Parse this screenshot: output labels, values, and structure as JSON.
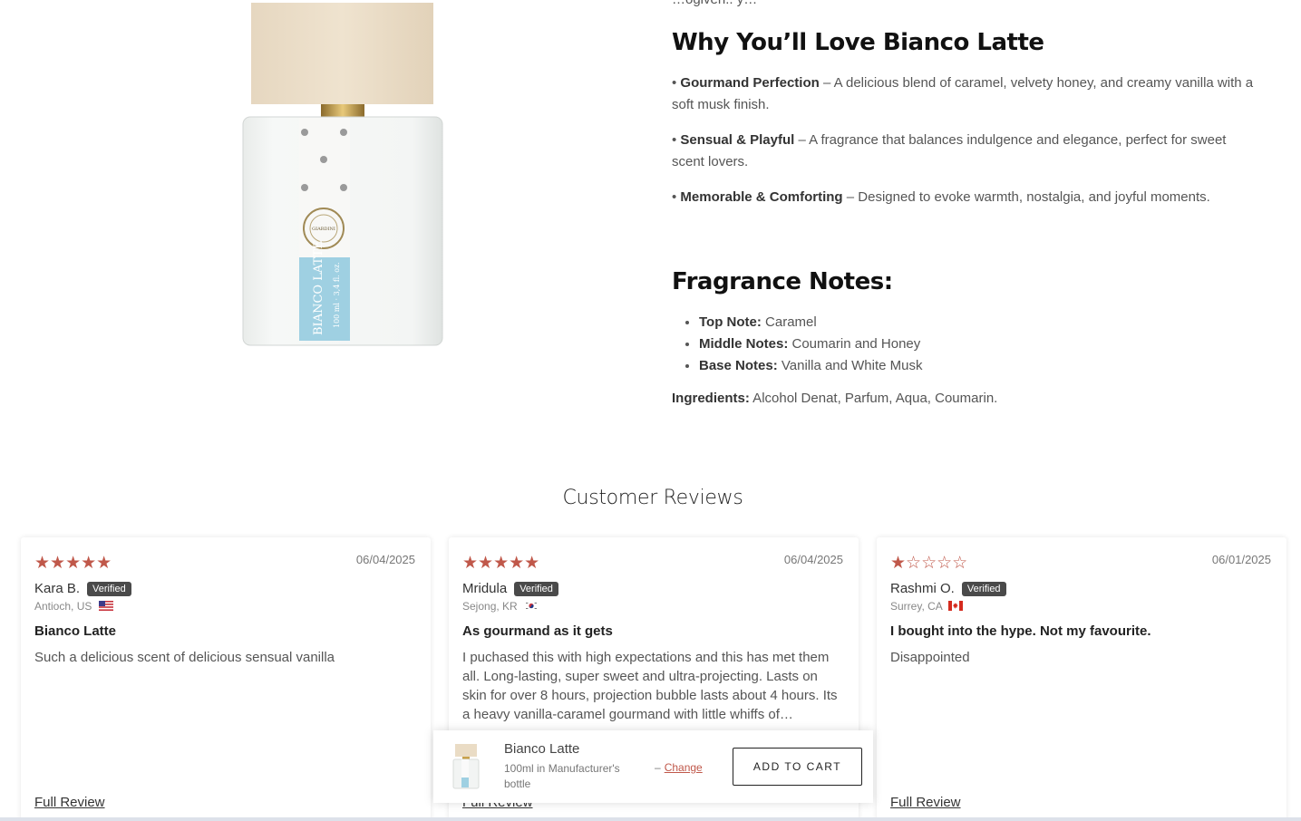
{
  "description": {
    "cut_line": "…ogiven.. y…",
    "why_heading": "Why You’ll Love Bianco Latte",
    "bullets": [
      {
        "title": "Gourmand Perfection",
        "text": " – A delicious blend of caramel, velvety honey, and creamy vanilla with a soft musk finish."
      },
      {
        "title": "Sensual & Playful",
        "text": " – A fragrance that balances indulgence and elegance, perfect for sweet scent lovers."
      },
      {
        "title": "Memorable & Comforting",
        "text": " – Designed to evoke warmth, nostalgia, and joyful moments."
      }
    ],
    "notes_heading": "Fragrance Notes:",
    "notes": [
      {
        "label": "Top Note:",
        "value": " Caramel"
      },
      {
        "label": "Middle Notes:",
        "value": " Coumarin and Honey"
      },
      {
        "label": "Base Notes:",
        "value": " Vanilla and White Musk"
      }
    ],
    "ingredients_label": "Ingredients:",
    "ingredients_value": " Alcohol Denat, Parfum, Aqua, Coumarin."
  },
  "reviews": {
    "heading": "Customer Reviews",
    "star_color": "#c0584a",
    "items": [
      {
        "stars": "★★★★★",
        "rating": 5,
        "date": "06/04/2025",
        "name": "Kara B.",
        "badge": "Verified",
        "location": "Antioch, US",
        "country": "US",
        "title": "Bianco Latte",
        "body": "Such a delicious scent of delicious sensual vanilla",
        "link": "Full Review"
      },
      {
        "stars": "★★★★★",
        "rating": 5,
        "date": "06/04/2025",
        "name": "Mridula",
        "badge": "Verified",
        "location": "Sejong, KR",
        "country": "KR",
        "title": "As gourmand as it gets",
        "body": "I puchased this with high expectations and this has met them all. Long-lasting, super sweet and ultra-projecting. Lasts on skin for over 8 hours, projection bubble lasts about 4 hours. Its a heavy vanilla-caramel gourmand with little whiffs of…",
        "link": "Full Review"
      },
      {
        "stars": "★☆☆☆☆",
        "rating": 1,
        "date": "06/01/2025",
        "name": "Rashmi O.",
        "badge": "Verified",
        "location": "Surrey, CA",
        "country": "CA",
        "title": "I bought into the hype. Not my favourite.",
        "body": "Disappointed",
        "link": "Full Review"
      }
    ]
  },
  "cart_bar": {
    "product_name": "Bianco Latte",
    "variant": "100ml in Manufacturer's bottle",
    "change_prefix": "–",
    "change_link": "Change",
    "button": "ADD TO CART"
  },
  "bottle_label": {
    "brand": "GIARDINI DI TOSCANA",
    "name": "Bianco Latte",
    "volume": "100 ml · 3,4 fl. oz."
  }
}
